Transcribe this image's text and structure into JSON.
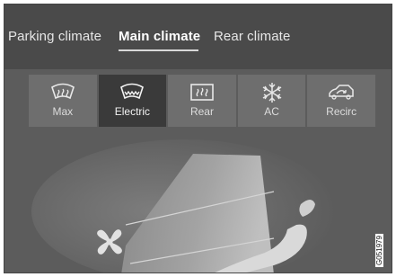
{
  "tabs": [
    {
      "label": "Parking climate"
    },
    {
      "label": "Main climate"
    },
    {
      "label": "Rear climate"
    }
  ],
  "active_tab": "Main climate",
  "buttons": [
    {
      "label": "Max",
      "icon": "max-defrost-icon"
    },
    {
      "label": "Electric",
      "icon": "electric-windshield-heater-icon",
      "active": true
    },
    {
      "label": "Rear",
      "icon": "rear-window-defrost-icon"
    },
    {
      "label": "AC",
      "icon": "ac-snowflake-icon"
    },
    {
      "label": "Recirc",
      "icon": "recirculation-icon"
    }
  ],
  "reference_code": "G051979",
  "colors": {
    "background": "#5c5c5c",
    "tab_bar": "#4a4a4a",
    "button": "#6e6e6e",
    "button_active": "#3a3a3a"
  }
}
